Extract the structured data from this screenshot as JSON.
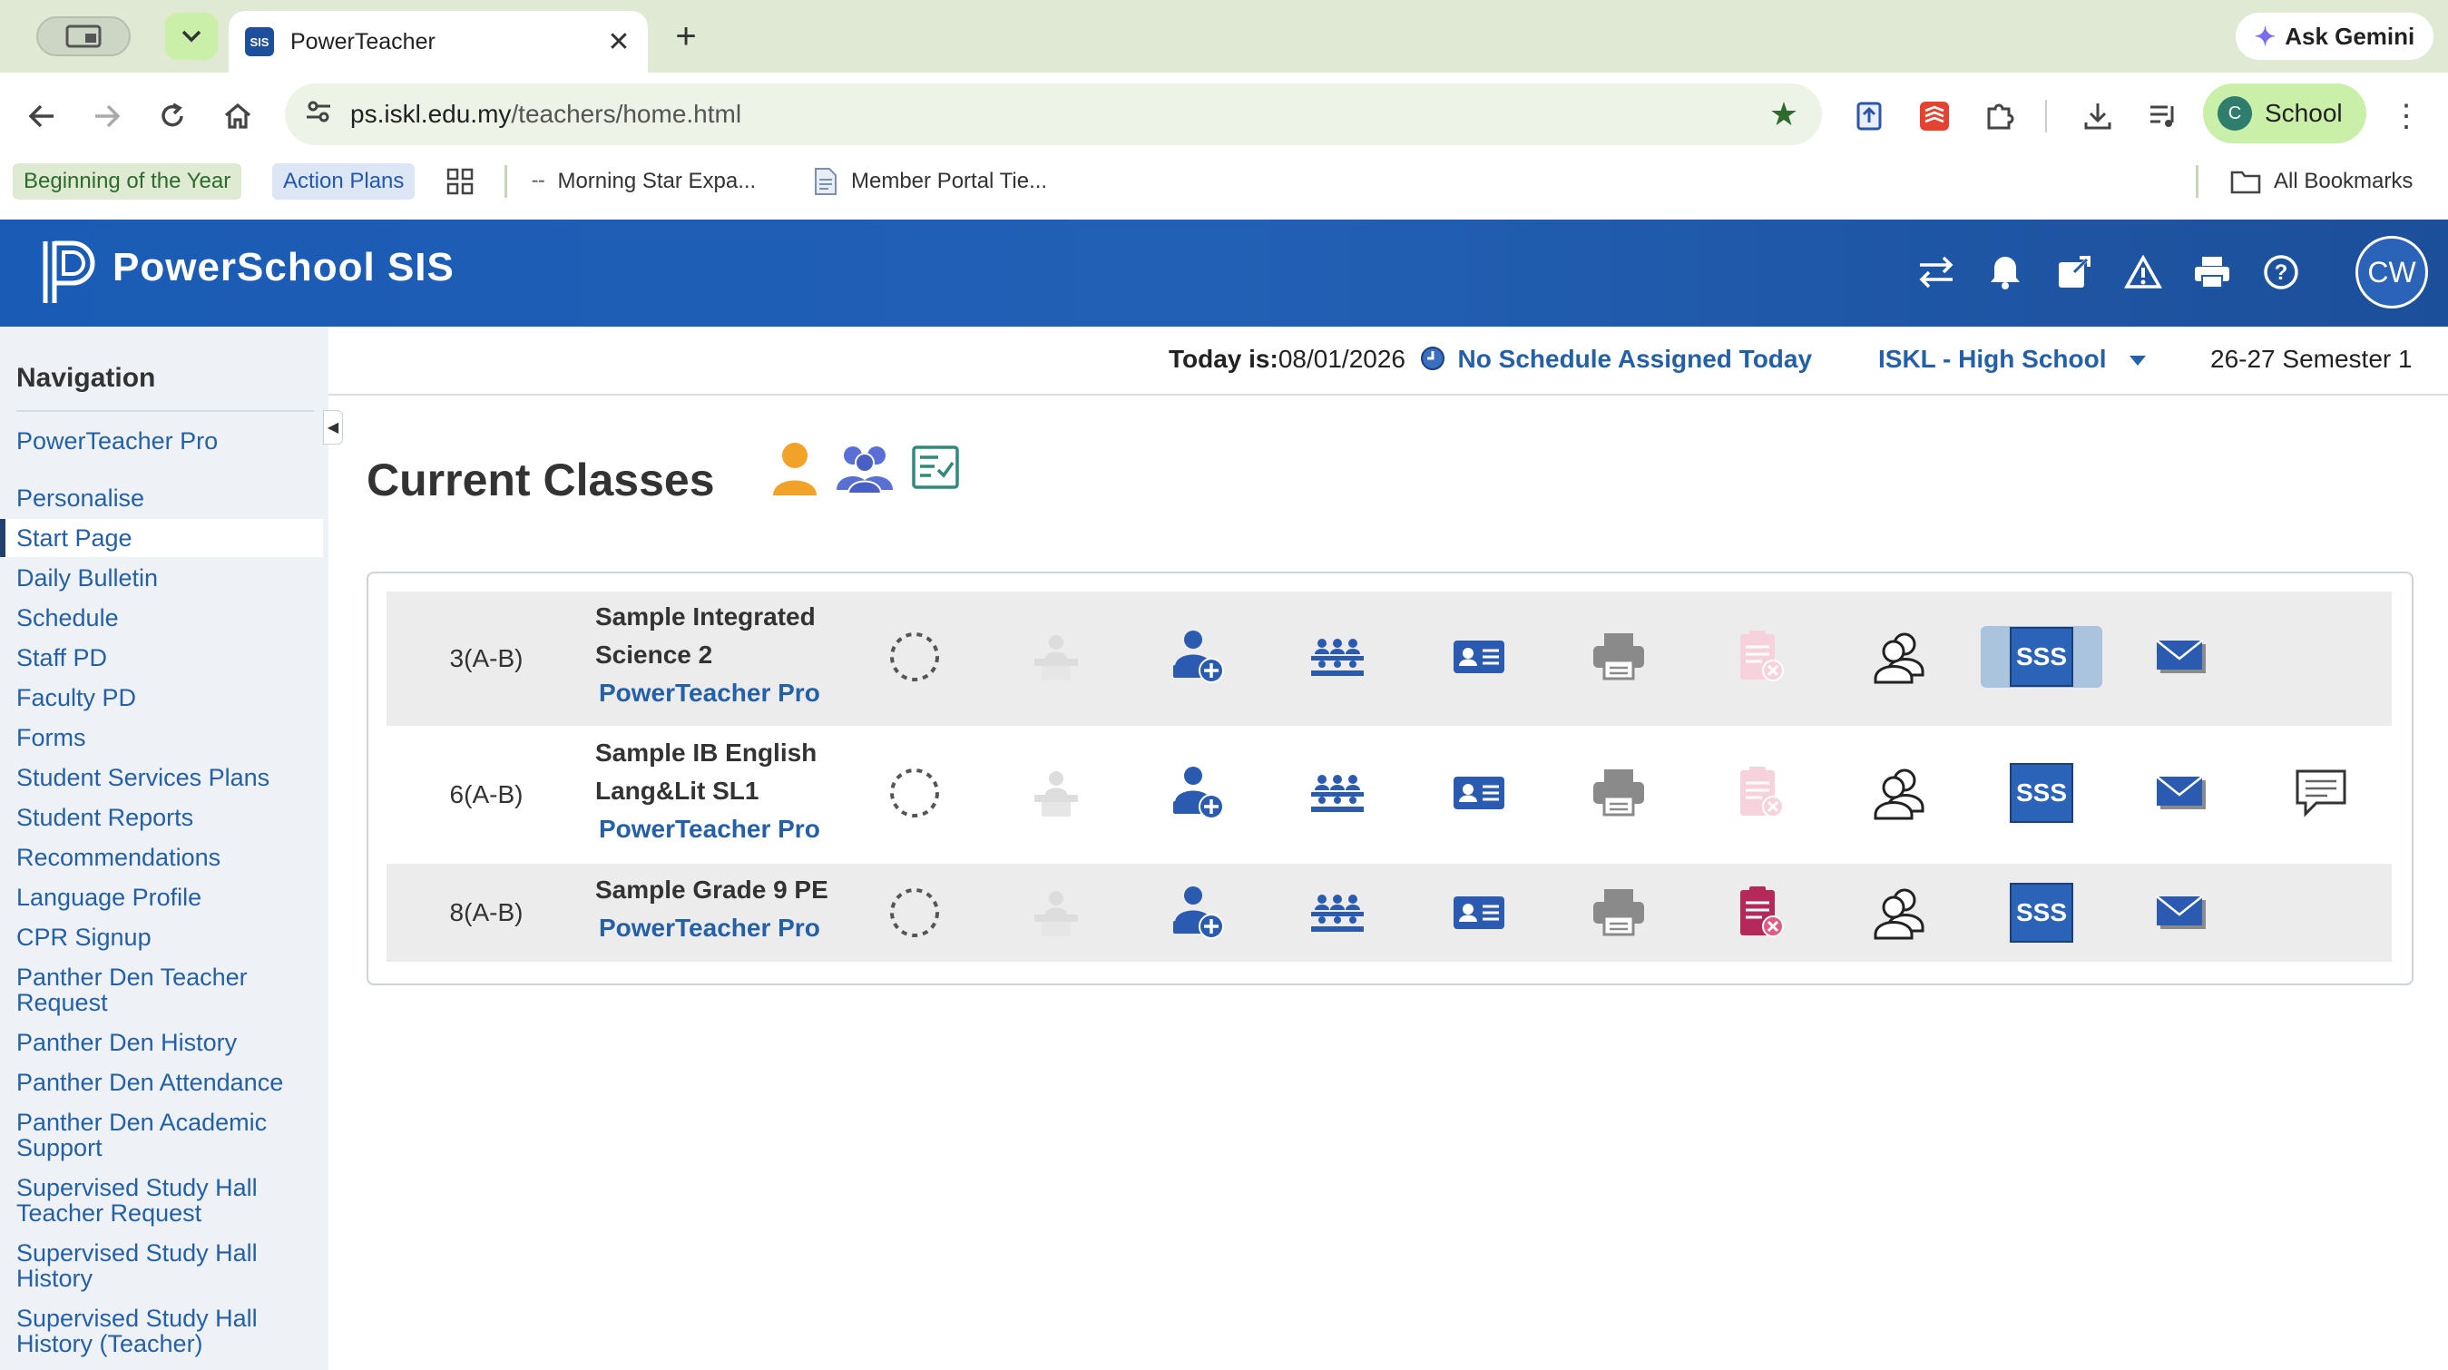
{
  "browser": {
    "tab_title": "PowerTeacher",
    "tab_favicon": "SIS",
    "gemini_label": "Ask Gemini",
    "url_host": "ps.iskl.edu.my",
    "url_path": "/teachers/home.html",
    "profile_initial": "C",
    "profile_label": "School",
    "bookmarks": [
      "Beginning of the Year",
      "Action Plans",
      "Morning Star Expa...",
      "Member Portal Tie..."
    ],
    "all_bookmarks": "All Bookmarks"
  },
  "header": {
    "title": "PowerSchool SIS",
    "user_initials": "CW",
    "brand_color": "#1a5bb5"
  },
  "nav": {
    "heading": "Navigation",
    "items": [
      "PowerTeacher Pro",
      "Personalise",
      "Start Page",
      "Daily Bulletin",
      "Schedule",
      "Staff PD",
      "Faculty PD",
      "Forms",
      "Student Services Plans",
      "Student Reports",
      "Recommendations",
      "Language Profile",
      "CPR Signup",
      "Panther Den Teacher Request",
      "Panther Den History",
      "Panther Den Attendance",
      "Panther Den Academic Support",
      "Supervised Study Hall Teacher Request",
      "Supervised Study Hall History",
      "Supervised Study Hall History (Teacher)"
    ],
    "active": "Start Page"
  },
  "infobar": {
    "today_label": "Today is:",
    "today_date": "08/01/2026",
    "schedule_status": "No Schedule Assigned Today",
    "school": "ISKL - High School",
    "term": "26-27 Semester 1"
  },
  "main": {
    "title": "Current Classes",
    "sss_label": "SSS",
    "classes": [
      {
        "period": "3(A-B)",
        "name_line1": "Sample Integrated",
        "name_line2": "Science 2",
        "link": "PowerTeacher Pro"
      },
      {
        "period": "6(A-B)",
        "name_line1": "Sample IB English",
        "name_line2": "Lang&Lit SL1",
        "link": "PowerTeacher Pro"
      },
      {
        "period": "8(A-B)",
        "name_line1": "Sample Grade 9 PE",
        "name_line2": "",
        "link": "PowerTeacher Pro"
      }
    ]
  }
}
